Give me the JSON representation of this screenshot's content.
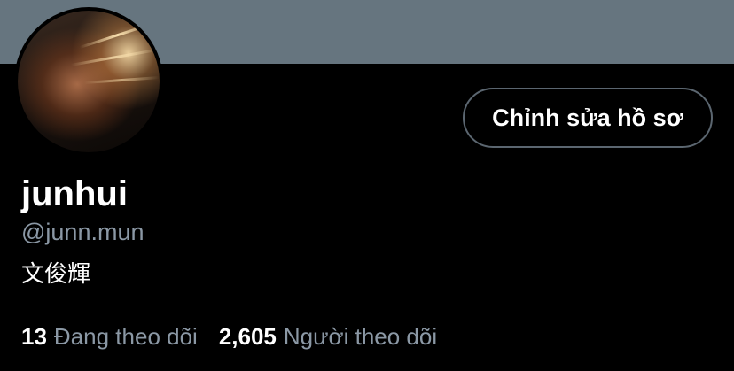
{
  "profile": {
    "display_name": "junhui",
    "handle": "@junn.mun",
    "bio": "文俊輝",
    "edit_button_label": "Chỉnh sửa hồ sơ",
    "following_count": "13",
    "following_label": "Đang theo dõi",
    "followers_count": "2,605",
    "followers_label": "Người theo dõi"
  },
  "colors": {
    "banner": "#66757f",
    "background": "#000000",
    "secondary_text": "#8b98a5",
    "button_border": "#5b6670"
  }
}
